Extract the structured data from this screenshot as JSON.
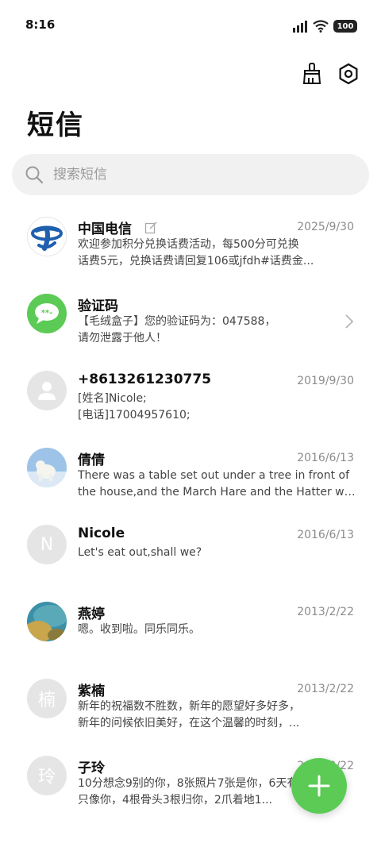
{
  "status_bar": {
    "time": "8:16",
    "battery": "100",
    "icons": [
      "signal-icon",
      "wifi-icon",
      "battery-icon"
    ]
  },
  "toolbar": {
    "icons": [
      "broom-icon",
      "settings-icon"
    ]
  },
  "page_title": "短信",
  "search": {
    "placeholder": "搜索短信"
  },
  "conversations": [
    {
      "name": "中国电信",
      "date": "2025/9/30",
      "preview_line1": "欢迎参加积分兑换话费活动，每500分可兑换",
      "preview_line2": "话费5元，兑换话费请回复106或jfdh#话费金..."
    },
    {
      "name": "验证码",
      "date": "",
      "preview_line1": "【毛绒盒子】您的验证码为：047588，",
      "preview_line2": "请勿泄露于他人！"
    },
    {
      "name": "+8613261230775",
      "date": "2019/9/30",
      "preview_line1": "[姓名]Nicole;",
      "preview_line2": "[电话]17004957610;"
    },
    {
      "name": "倩倩",
      "date": "2016/6/13",
      "preview_line1": "There was a table set out under a tree in front of",
      "preview_line2": "the house,and the March Hare and the Hatter were..."
    },
    {
      "name": "Nicole",
      "avatar_letter": "N",
      "date": "2016/6/13",
      "preview_line1": "Let's eat out,shall we?",
      "preview_line2": ""
    },
    {
      "name": "燕婷",
      "date": "2013/2/22",
      "preview_line1": "嗯。收到啦。同乐同乐。",
      "preview_line2": ""
    },
    {
      "name": "紫楠",
      "avatar_letter": "楠",
      "date": "2013/2/22",
      "preview_line1": "新年的祝福数不胜数，新年的愿望好多好多，",
      "preview_line2": "新年的问候依旧美好，在这个温馨的时刻，..."
    },
    {
      "name": "子玲",
      "avatar_letter": "玲",
      "date": "2013/2/22",
      "preview_line1": "10分想念9别的你，8张照片7张是你，6天有5",
      "preview_line2": "只像你，4根骨头3根归你，2爪着地1..."
    }
  ],
  "colors": {
    "accent_green": "#5bcb55",
    "telecom_blue": "#1f5fae",
    "search_bg": "#f1f1f1",
    "avatar_grey": "#e5e5e5"
  },
  "fab": {
    "icon": "plus-icon"
  }
}
